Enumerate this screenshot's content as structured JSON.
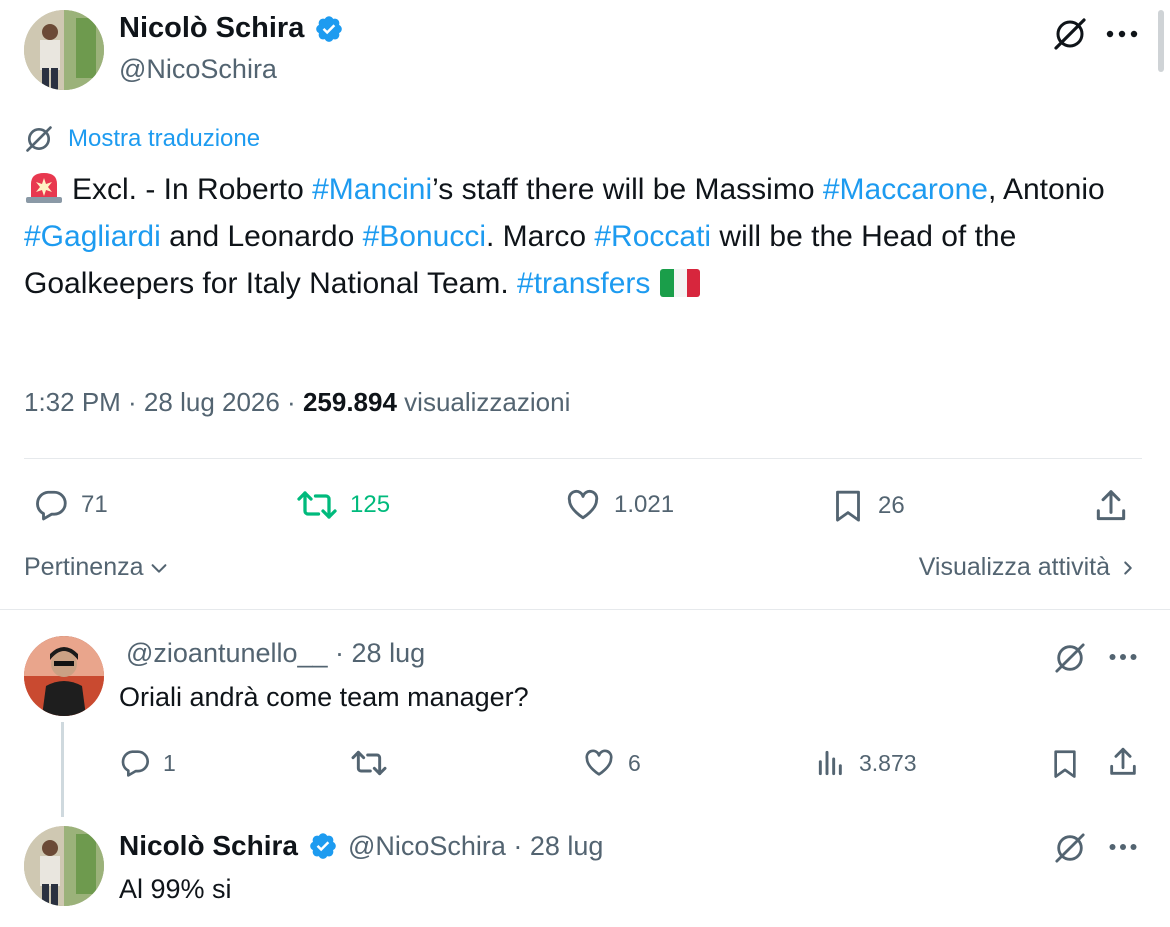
{
  "main_tweet": {
    "author_name": "Nicolò Schira",
    "author_handle": "@NicoSchira",
    "translate_label": "Mostra traduzione",
    "text_segments": [
      {
        "t": "Excl. - In Roberto ",
        "tag": false
      },
      {
        "t": "#Mancini",
        "tag": true
      },
      {
        "t": "’s staff there will be Massimo ",
        "tag": false
      },
      {
        "t": "#Maccarone",
        "tag": true
      },
      {
        "t": ", Antonio ",
        "tag": false
      },
      {
        "t": "#Gagliardi",
        "tag": true
      },
      {
        "t": " and Leonardo ",
        "tag": false
      },
      {
        "t": "#Bonucci",
        "tag": true
      },
      {
        "t": ". Marco ",
        "tag": false
      },
      {
        "t": "#Roccati",
        "tag": true
      },
      {
        "t": " will be the Head of the Goalkeepers for Italy National Team. ",
        "tag": false
      },
      {
        "t": "#transfers",
        "tag": true
      }
    ],
    "time": "1:32 PM · 28 lug 2026 · ",
    "views_count": "259.894",
    "views_label": " visualizzazioni",
    "stats": {
      "replies": "71",
      "retweets": "125",
      "likes": "1.021",
      "bookmarks": "26"
    }
  },
  "sort_label": "Pertinenza",
  "activity_label": "Visualizza attività",
  "reply_1": {
    "handle": "@zioantunello__ · 28 lug",
    "text": "Oriali andrà come team manager?",
    "stats": {
      "replies": "1",
      "likes": "6",
      "views": "3.873"
    }
  },
  "reply_2": {
    "author_name": "Nicolò Schira",
    "handle": "@NicoSchira · 28 lug",
    "text": "Al 99% si"
  },
  "colors": {
    "accent": "#1d9bf0",
    "retweet_green": "#00ba7c",
    "muted": "#536471",
    "text": "#0f1419"
  },
  "icons": [
    "verified-badge-icon",
    "grok-icon",
    "more-icon",
    "reply-icon",
    "retweet-icon",
    "like-icon",
    "bookmark-icon",
    "share-icon",
    "views-icon",
    "chevron-down-icon",
    "chevron-right-icon",
    "siren-emoji-icon",
    "italy-flag-icon"
  ]
}
